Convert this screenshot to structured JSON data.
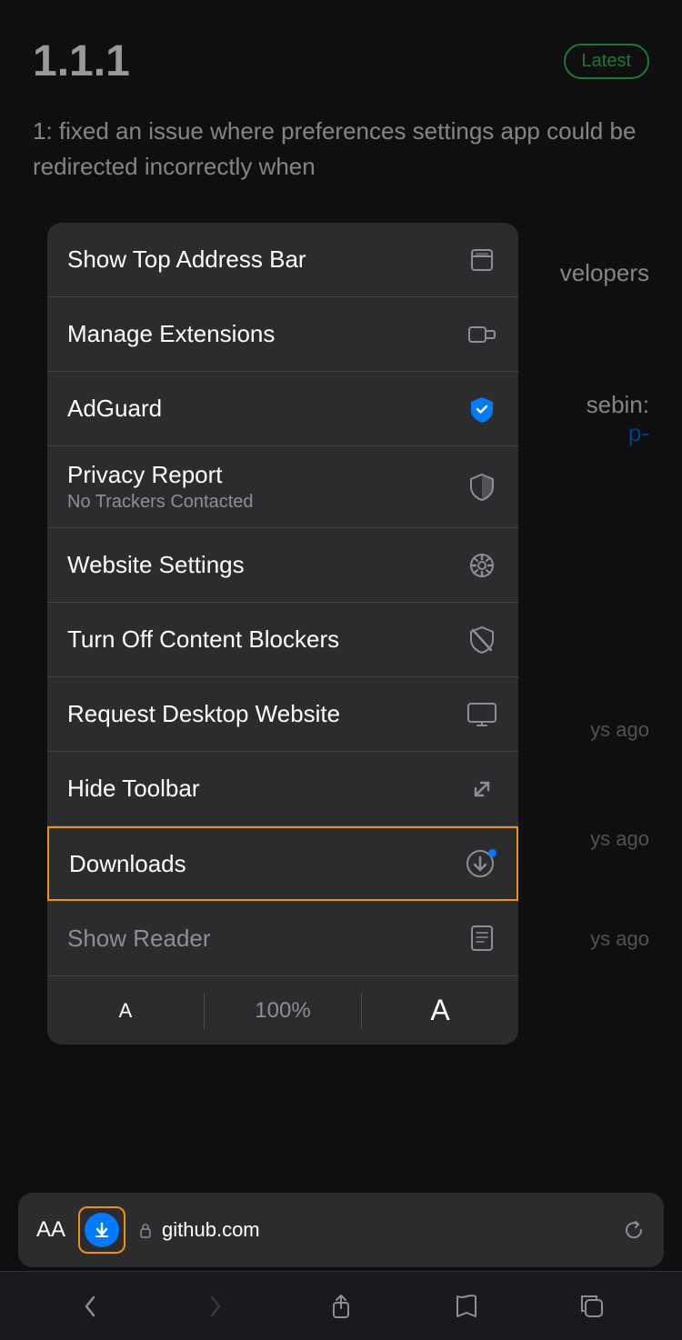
{
  "version": {
    "number": "1.1.1",
    "badge": "Latest"
  },
  "background": {
    "description": "1: fixed an issue where preferences settings app could be redirected incorrectly when",
    "right_text": "velopers",
    "sebin_text": "sebin:",
    "link_text": "p-",
    "days_1": "ys ago",
    "days_2": "ys ago",
    "days_3": "ys ago"
  },
  "menu": {
    "items": [
      {
        "id": "show-top-address-bar",
        "label": "Show Top Address Bar",
        "sublabel": null,
        "icon": "address-bar-icon"
      },
      {
        "id": "manage-extensions",
        "label": "Manage Extensions",
        "sublabel": null,
        "icon": "extensions-icon"
      },
      {
        "id": "adguard",
        "label": "AdGuard",
        "sublabel": null,
        "icon": "adguard-icon"
      },
      {
        "id": "privacy-report",
        "label": "Privacy Report",
        "sublabel": "No Trackers Contacted",
        "icon": "privacy-icon"
      },
      {
        "id": "website-settings",
        "label": "Website Settings",
        "sublabel": null,
        "icon": "settings-icon"
      },
      {
        "id": "turn-off-content-blockers",
        "label": "Turn Off Content Blockers",
        "sublabel": null,
        "icon": "blockers-icon"
      },
      {
        "id": "request-desktop-website",
        "label": "Request Desktop Website",
        "sublabel": null,
        "icon": "desktop-icon"
      },
      {
        "id": "hide-toolbar",
        "label": "Hide Toolbar",
        "sublabel": null,
        "icon": "hide-toolbar-icon"
      },
      {
        "id": "downloads",
        "label": "Downloads",
        "sublabel": null,
        "icon": "downloads-icon",
        "highlighted": true
      },
      {
        "id": "show-reader",
        "label": "Show Reader",
        "sublabel": null,
        "icon": "reader-icon"
      }
    ],
    "font_size": {
      "small_a": "A",
      "percent": "100%",
      "large_a": "A"
    }
  },
  "toolbar": {
    "aa_label": "AA",
    "url": "github.com"
  },
  "nav": {
    "back": "‹",
    "forward": "›"
  }
}
